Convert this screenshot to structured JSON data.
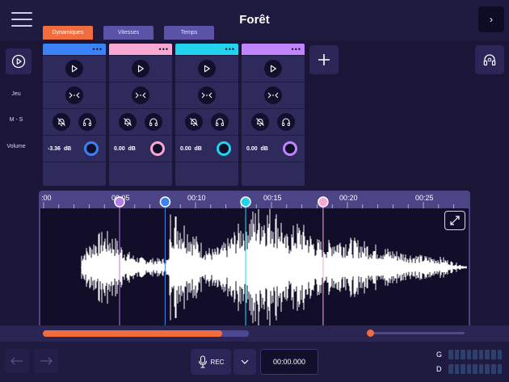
{
  "header": {
    "title": "Forêt",
    "menu_icon": "hamburger-menu-icon",
    "next_icon": "chevron-right-icon",
    "next_glyph": "›"
  },
  "tabs": [
    {
      "label": "Dynamiques",
      "active": true
    },
    {
      "label": "Vitesses",
      "active": false
    },
    {
      "label": "Temps",
      "active": false
    }
  ],
  "sidebar": {
    "play_icon": "play-circle-icon",
    "labels": {
      "play": "Jeu",
      "mute_solo": "M - S",
      "volume": "Volume"
    }
  },
  "tracks": [
    {
      "color": "#3b82f6",
      "volume": "-3.36",
      "unit": "dB",
      "menu": "•••"
    },
    {
      "color": "#f9a8d4",
      "volume": "0.00",
      "unit": "dB",
      "menu": "•••"
    },
    {
      "color": "#22d3ee",
      "volume": "0.00",
      "unit": "dB",
      "menu": "•••"
    },
    {
      "color": "#c084fc",
      "volume": "0.00",
      "unit": "dB",
      "menu": "•••"
    }
  ],
  "add_track_icon": "plus-icon",
  "headphones_icon": "headphones-icon",
  "timeline": {
    "labels": [
      ":00",
      "00:05",
      "00:10",
      "00:15",
      "00:20",
      "00:25"
    ],
    "markers": [
      {
        "time": 5,
        "color": "#b57de6",
        "name": "marker-purple"
      },
      {
        "time": 8,
        "color": "#3b82f6",
        "name": "marker-blue"
      },
      {
        "time": 13.3,
        "color": "#22d3ee",
        "name": "marker-cyan"
      },
      {
        "time": 18.4,
        "color": "#f9a8d4",
        "name": "marker-pink"
      }
    ],
    "expand_icon": "expand-arrows-icon"
  },
  "transport": {
    "progress_fraction": 0.87,
    "zoom_fraction": 0.0,
    "rec_label": "REC",
    "mic_icon": "microphone-icon",
    "dropdown_icon": "chevron-down-icon",
    "time": "00:00.000",
    "undo_icon": "undo-icon",
    "redo_icon": "redo-icon"
  },
  "meters": {
    "left": "G",
    "right": "D",
    "segments": 9
  }
}
